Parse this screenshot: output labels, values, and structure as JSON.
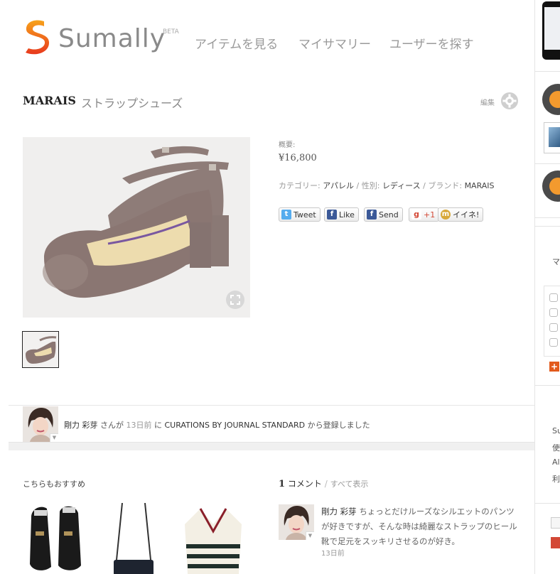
{
  "header": {
    "brand": "Sumally",
    "beta": "BETA",
    "nav": [
      "アイテムを見る",
      "マイサマリー",
      "ユーザーを探す"
    ]
  },
  "item": {
    "brand_name": "MARAIS",
    "title": "ストラップシューズ",
    "edit_label": "編集",
    "overview_label": "概要:",
    "price": "¥16,800",
    "category_label": "カテゴリー:",
    "category": "アパレル",
    "gender_label": "性別:",
    "gender": "レディース",
    "brand_label": "ブランド:",
    "brand": "MARAIS",
    "separator": "/"
  },
  "share": {
    "tweet": "Tweet",
    "like": "Like",
    "send": "Send",
    "plus_one": "+1",
    "iine": "イイネ!"
  },
  "registration": {
    "user": "剛力 彩芽",
    "san": "さんが",
    "when": "13日前",
    "ni": "に",
    "source": "CURATIONS BY JOURNAL STANDARD",
    "suffix": "から登録しました"
  },
  "recommend": {
    "title": "こちらもおすすめ"
  },
  "comments": {
    "count": "1",
    "label": "コメント",
    "separator": "/",
    "show_all": "すべて表示",
    "items": [
      {
        "user": "剛力 彩芽",
        "text": "ちょっとだけルーズなシルエットのパンツが好きですが、そんな時は綺麗なストラップのヒール靴で足元をスッキリさせるのが好き。",
        "time": "13日前"
      }
    ]
  },
  "sidebar": {
    "text_ma": "マ",
    "links": [
      "Su",
      "使",
      "Al",
      "利"
    ]
  },
  "colors": {
    "accent_orange": "#f39a2e",
    "brand_grey": "#8a8a8a",
    "plus_red": "#e25a1c"
  }
}
